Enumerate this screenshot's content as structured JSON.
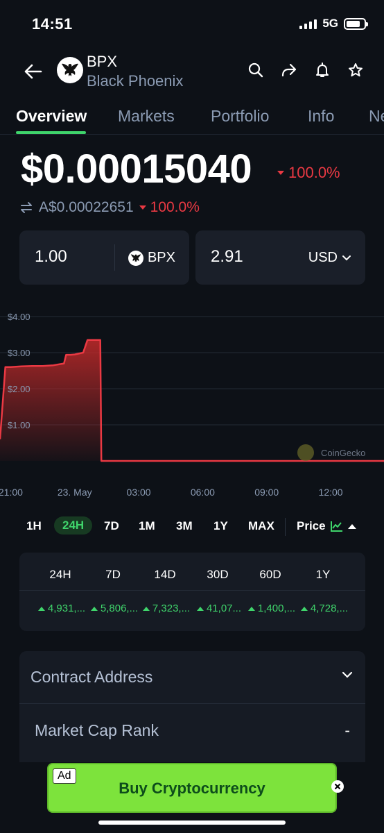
{
  "status_bar": {
    "time": "14:51",
    "network": "5G",
    "battery_level": 0.8
  },
  "header": {
    "symbol": "BPX",
    "name": "Black Phoenix",
    "icons": [
      "arrow-left-icon",
      "search-icon",
      "share-icon",
      "bell-icon",
      "star-icon"
    ]
  },
  "tabs": [
    {
      "label": "Overview",
      "active": true
    },
    {
      "label": "Markets"
    },
    {
      "label": "Portfolio"
    },
    {
      "label": "Info"
    },
    {
      "label": "Ne"
    }
  ],
  "price": {
    "main": "$0.00015040",
    "change": "100.0%",
    "alt": "A$0.00022651",
    "alt_change": "100.0%",
    "down_color": "#ea3943"
  },
  "converter": {
    "left_value": "1.00",
    "left_unit": "BPX",
    "right_value": "2.91",
    "right_unit": "USD"
  },
  "chart_data": {
    "type": "area",
    "watermark": "CoinGecko",
    "y_tick_labels": [
      "$4.00",
      "$3.00",
      "$2.00",
      "$1.00"
    ],
    "y_ticks": [
      4,
      3,
      2,
      1
    ],
    "ylim": [
      0,
      4.0
    ],
    "x_tick_labels": [
      "21:00",
      "23. May",
      "03:00",
      "06:00",
      "09:00",
      "12:00"
    ],
    "x_ticks": [
      21,
      24,
      27,
      30,
      33,
      36
    ],
    "xlim": [
      20.5,
      38.5
    ],
    "x_unit": "hours (24 = 23. May 00:00)",
    "series": [
      {
        "x": [
          20.5,
          20.75,
          21.0,
          21.5,
          22.0,
          22.5,
          23.0,
          23.5,
          23.6,
          23.8,
          24.0,
          24.4,
          24.6,
          25.0,
          25.2,
          25.25,
          35.0,
          38.5
        ],
        "y": [
          0.6,
          2.6,
          2.6,
          2.62,
          2.63,
          2.63,
          2.65,
          2.7,
          2.94,
          2.94,
          2.95,
          3.0,
          3.35,
          3.35,
          3.35,
          0.0,
          0.0,
          0.0
        ]
      }
    ],
    "line_color": "#ea3943",
    "grid": true
  },
  "ranges": {
    "items": [
      "1H",
      "24H",
      "7D",
      "1M",
      "3M",
      "1Y",
      "MAX"
    ],
    "active": "24H",
    "price_toggle": "Price"
  },
  "performance": {
    "headers": [
      "24H",
      "7D",
      "14D",
      "30D",
      "60D",
      "1Y"
    ],
    "values": [
      "4,931,...",
      "5,806,...",
      "7,323,...",
      "41,07...",
      "1,400,...",
      "4,728,..."
    ],
    "up_color": "#3fd46b"
  },
  "info": {
    "contract_label": "Contract Address",
    "rank_label": "Market Cap Rank",
    "rank_value": "-"
  },
  "ad": {
    "badge": "Ad",
    "text": "Buy Cryptocurrency",
    "color": "#7de33c"
  }
}
